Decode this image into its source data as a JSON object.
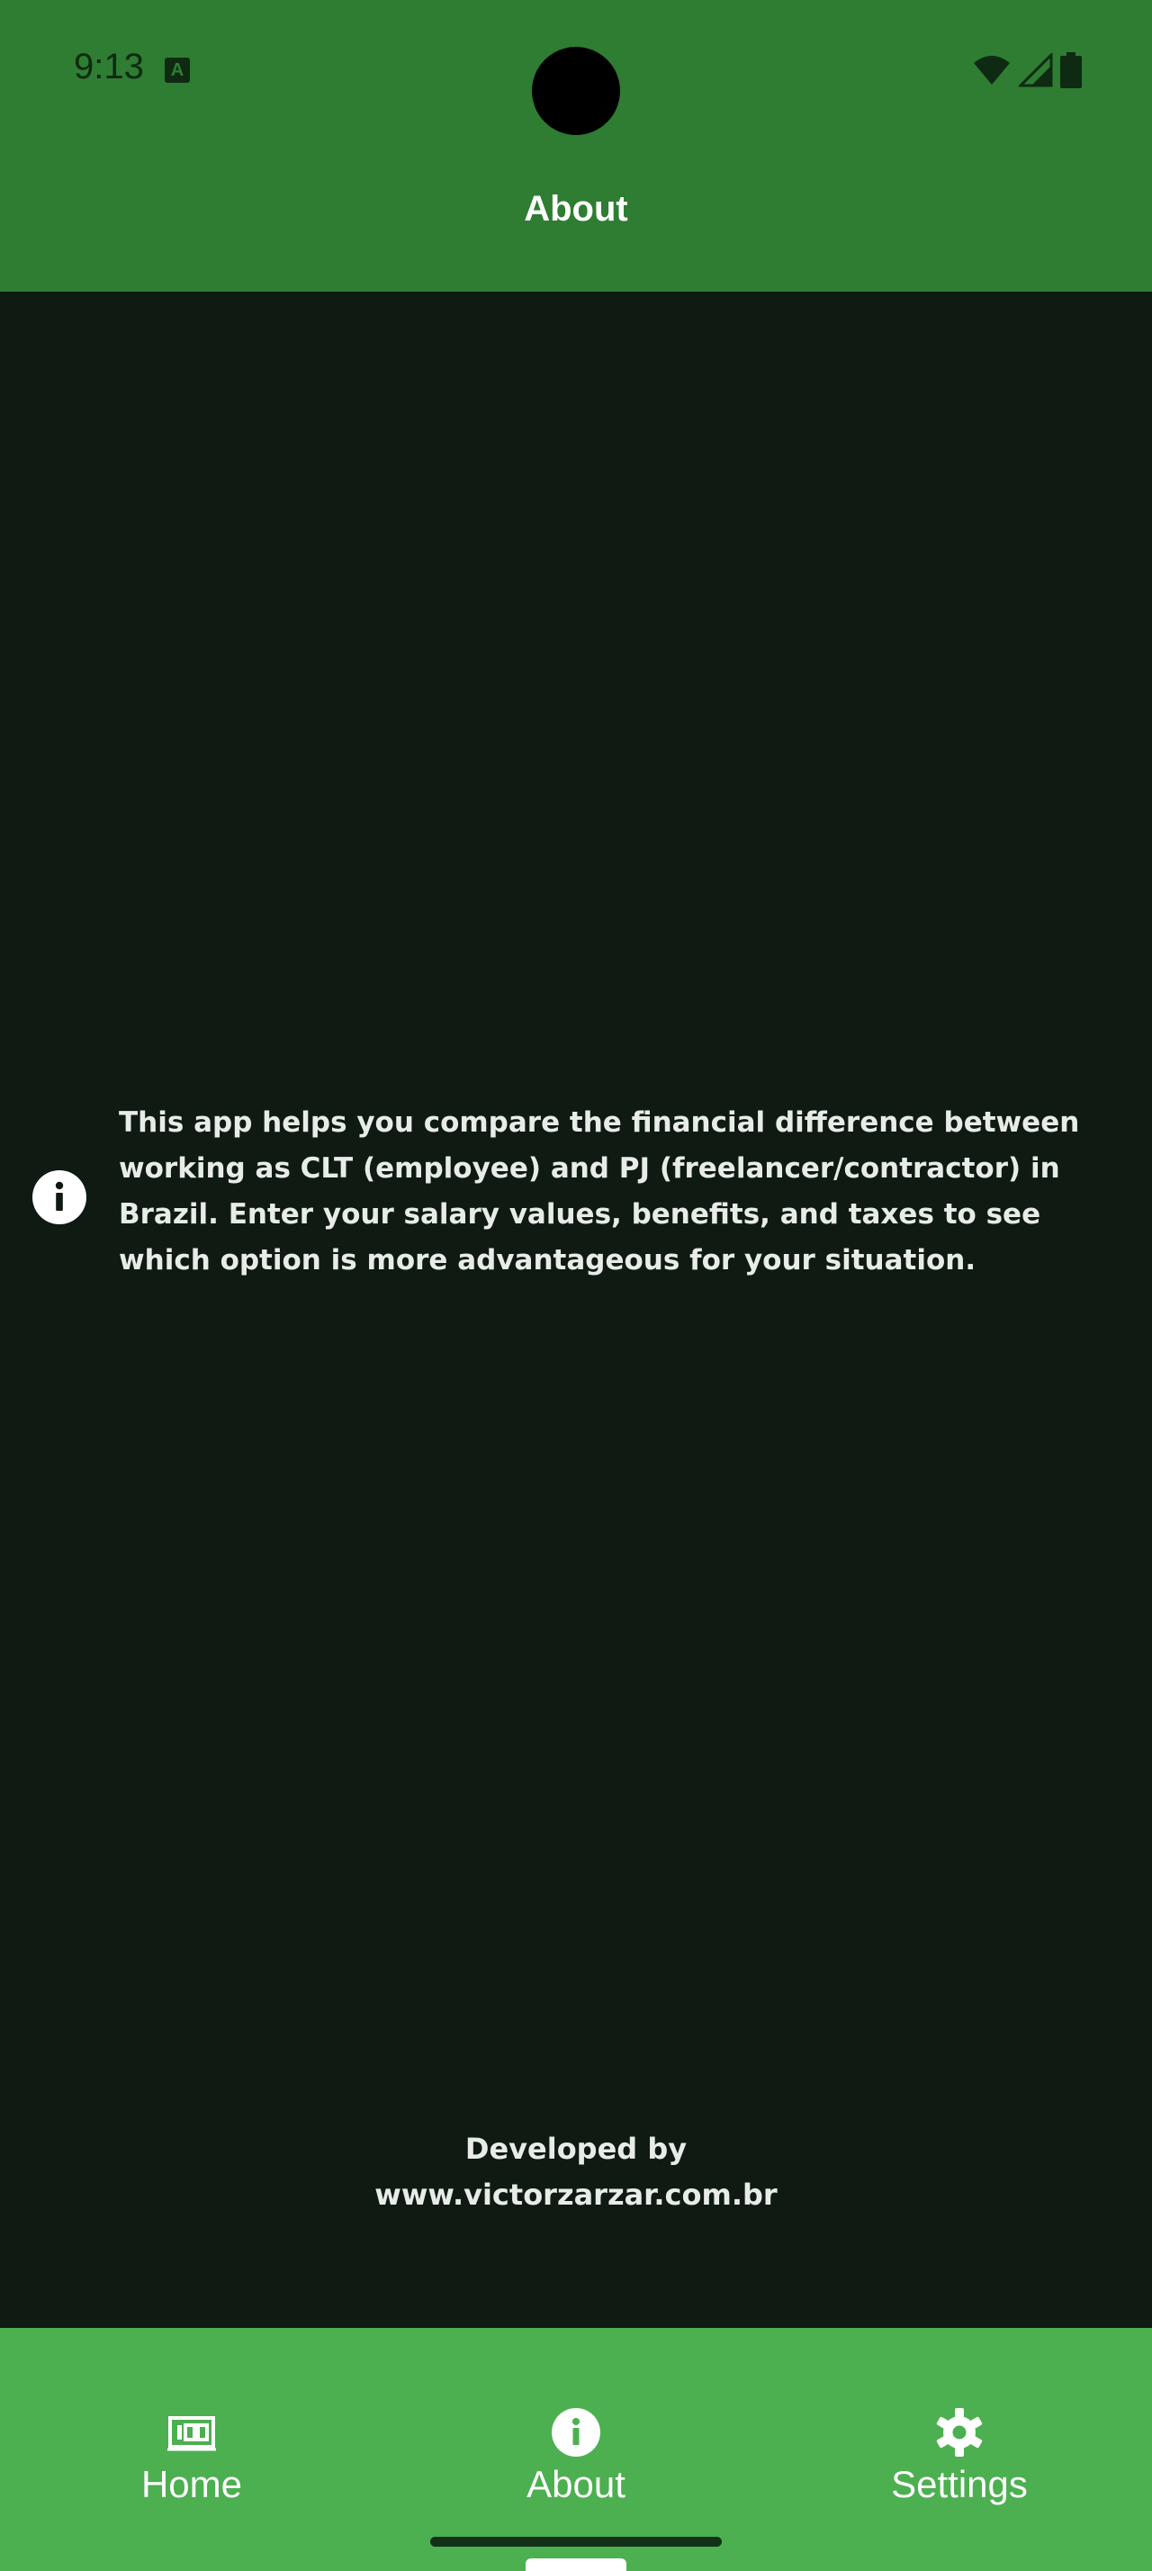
{
  "status_bar": {
    "time": "9:13",
    "notification_icon": "a-icon",
    "icons": [
      "wifi-icon",
      "signal-icon",
      "battery-icon"
    ]
  },
  "header": {
    "title": "About"
  },
  "info": {
    "icon": "info-icon",
    "text": "This app helps you compare the financial difference between working as CLT (employee) and PJ (freelancer/contractor) in Brazil. Enter your salary values, benefits, and taxes to see which option is more advantageous for your situation."
  },
  "developer": {
    "line1": "Developed by",
    "line2": "www.victorzarzar.com.br"
  },
  "bottom_nav": {
    "items": [
      {
        "label": "Home",
        "icon": "money-icon",
        "active": false
      },
      {
        "label": "About",
        "icon": "info-icon",
        "active": true
      },
      {
        "label": "Settings",
        "icon": "gear-icon",
        "active": false
      }
    ]
  },
  "colors": {
    "header_bg": "#2e7d32",
    "body_bg": "#0f1a12",
    "nav_bg": "#4caf50",
    "text": "#e8ece8"
  }
}
